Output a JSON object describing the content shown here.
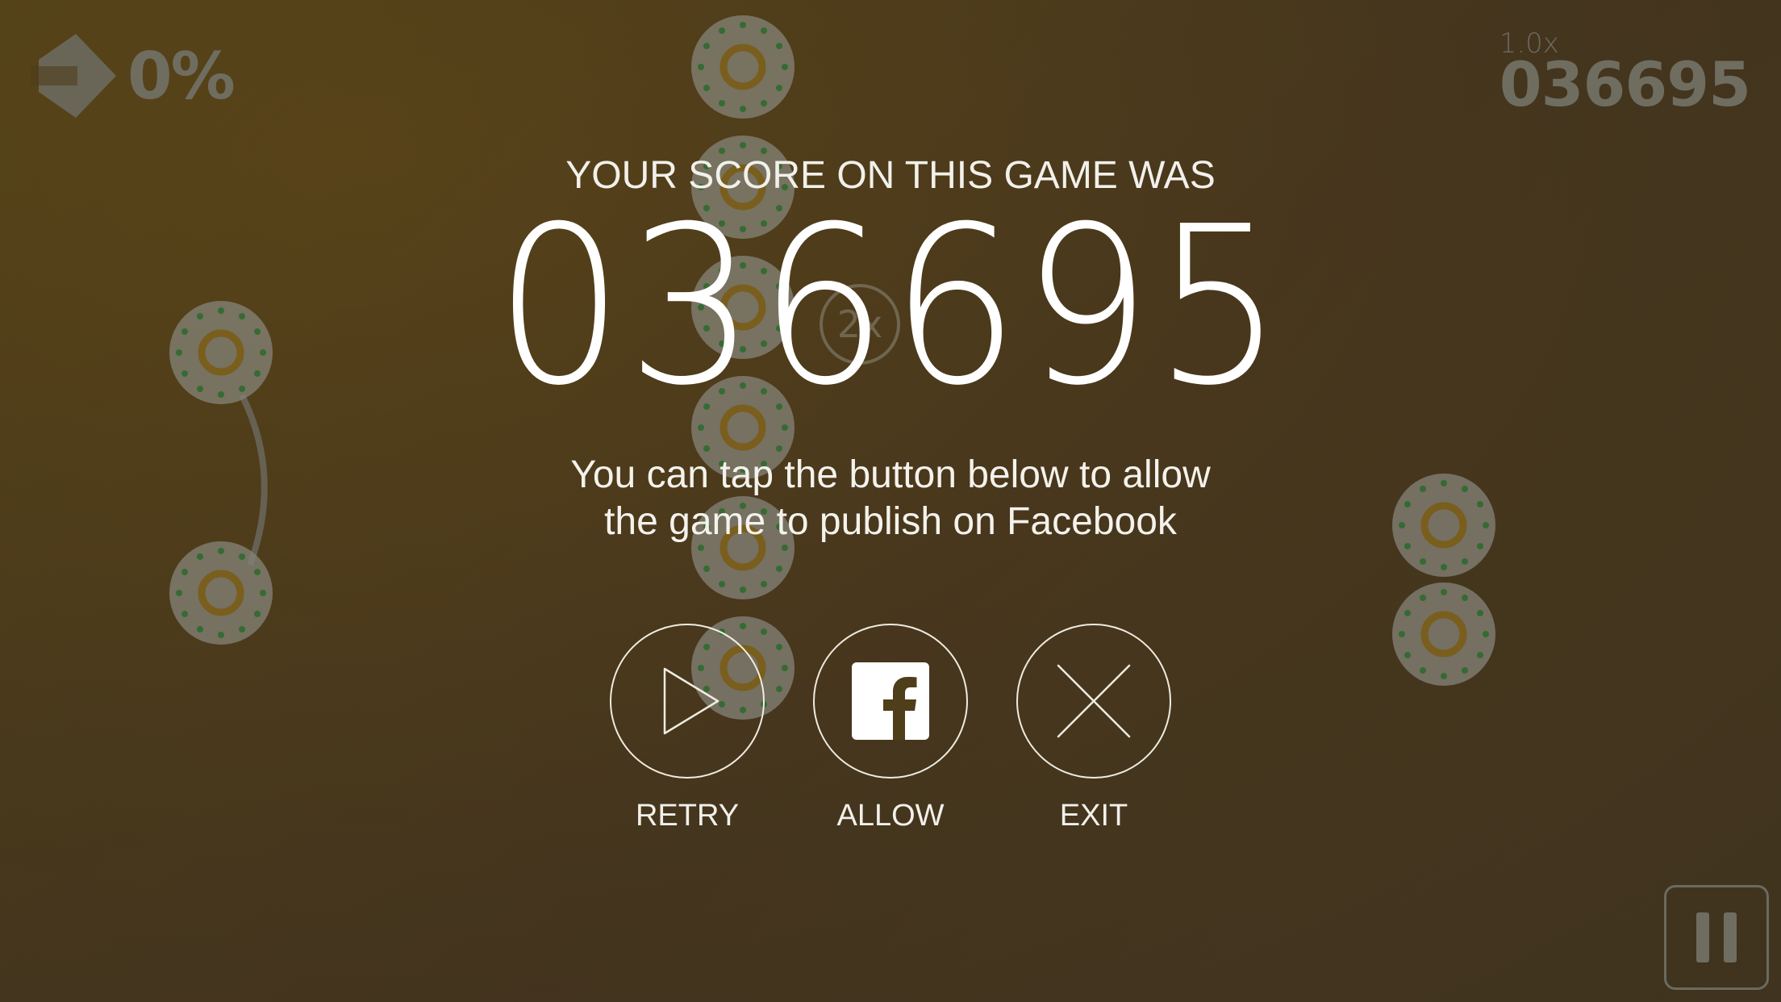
{
  "hud": {
    "progress_percent": "0%",
    "multiplier": "1.0x",
    "score": "036695"
  },
  "game_over": {
    "heading": "YOUR SCORE ON THIS GAME WAS",
    "score": "036695",
    "message_line1": "You can tap the button below to allow",
    "message_line2": "the game to publish on Facebook",
    "buttons": [
      {
        "label": "RETRY",
        "icon": "play-icon"
      },
      {
        "label": "ALLOW",
        "icon": "facebook-icon"
      },
      {
        "label": "EXIT",
        "icon": "close-icon"
      }
    ]
  },
  "board": {
    "bonus_label": "2x"
  },
  "colors": {
    "background": "#4f3e1a",
    "node": "#8a8a80",
    "node_ring": "#7a5a14",
    "node_dots": "#3a7a3a",
    "text": "#ffffff",
    "hud_text": "#6f6d60"
  }
}
